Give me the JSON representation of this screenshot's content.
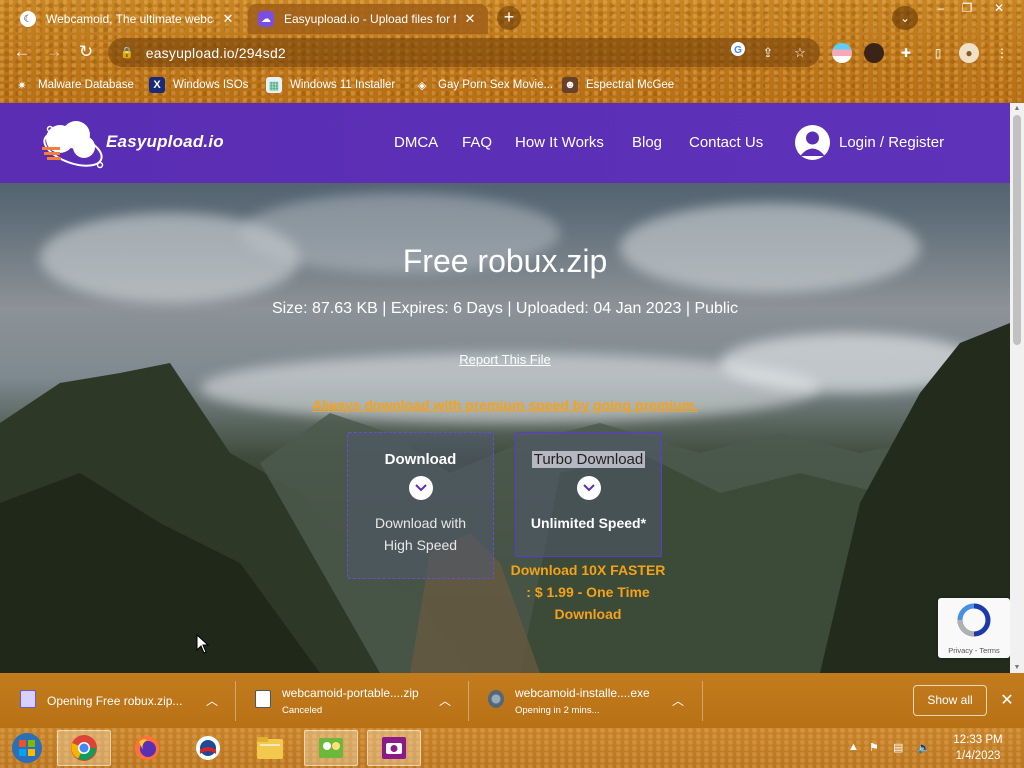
{
  "browser": {
    "tabs": [
      {
        "title": "Webcamoid, The ultimate webcam",
        "active": false
      },
      {
        "title": "Easyupload.io - Upload files for fr",
        "active": true
      }
    ],
    "url": "easyupload.io/294sd2",
    "bookmarks": [
      {
        "label": "Malware Database"
      },
      {
        "label": "Windows ISOs"
      },
      {
        "label": "Windows 11 Installer"
      },
      {
        "label": "Gay Porn Sex Movie..."
      },
      {
        "label": "Espectral McGee"
      }
    ]
  },
  "site": {
    "logo": "Easyupload.io",
    "nav": [
      "DMCA",
      "FAQ",
      "How It Works",
      "Blog",
      "Contact Us"
    ],
    "login": "Login / Register",
    "file_title": "Free robux.zip",
    "file_meta": "Size: 87.63 KB | Expires: 6 Days | Uploaded: 04 Jan 2023 | Public",
    "report": "Report This File",
    "premium_link": "Always download with premium speed by going premium.",
    "free_download": {
      "title": "Download",
      "sub1": "Download with",
      "sub2": "High Speed"
    },
    "turbo_download": {
      "title": "Turbo Download",
      "sub": "Unlimited Speed*"
    },
    "turbo_offer": {
      "line1": "Download 10X FASTER",
      "line2": ": $ 1.99 - One Time",
      "line3": "Download"
    },
    "recaptcha_terms": "Privacy - Terms"
  },
  "downloads": [
    {
      "name": "Opening Free robux.zip...",
      "status": ""
    },
    {
      "name": "webcamoid-portable....zip",
      "status": "Canceled"
    },
    {
      "name": "webcamoid-installe....exe",
      "status": "Opening in 2 mins..."
    }
  ],
  "download_shelf": {
    "show_all": "Show all"
  },
  "taskbar": {
    "time": "12:33 PM",
    "date": "1/4/2023"
  },
  "colors": {
    "brand_purple": "#5b2fb5",
    "premium_orange": "#f4a21a",
    "chrome_theme": "#c07a1c"
  }
}
